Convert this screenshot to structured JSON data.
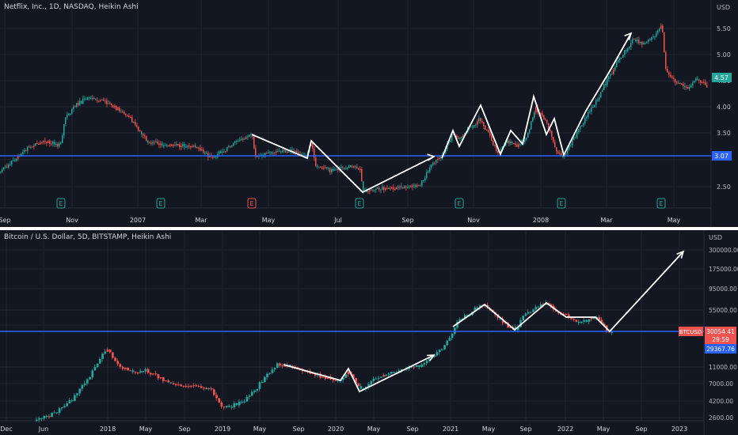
{
  "top_chart": {
    "title": "Netflix, Inc., 1D, NASDAQ, Heikin Ashi",
    "currency": "USD",
    "price_ticks": [
      "2.50",
      "3.00",
      "3.50",
      "4.00",
      "4.50",
      "5.00",
      "5.50"
    ],
    "time_labels": [
      "Sep",
      "Nov",
      "2007",
      "Mar",
      "May",
      "Jul",
      "Sep",
      "Nov",
      "2008",
      "Mar",
      "May"
    ],
    "current_price": "4.57",
    "hline_price": "3.07",
    "earnings_marker_label": "E",
    "colors": {
      "up": "#26a69a",
      "down": "#ef5350",
      "hline": "#2962ff",
      "arrows": "#ffffff"
    }
  },
  "bottom_chart": {
    "title": "Bitcoin / U.S. Dollar, 5D, BITSTAMP, Heikin Ashi",
    "currency": "USD",
    "price_ticks": [
      "2600.00",
      "4200.00",
      "7000.00",
      "11000.00",
      "35000.00",
      "55000.00",
      "95000.00",
      "175000.00",
      "300000.00"
    ],
    "time_labels": [
      "Dec",
      "Jun",
      "2018",
      "May",
      "Sep",
      "2019",
      "May",
      "Sep",
      "2020",
      "May",
      "Sep",
      "2021",
      "May",
      "Sep",
      "2022",
      "May",
      "Sep",
      "2023"
    ],
    "symbol_tag": "BTCUSD",
    "last_price": "30054.41",
    "countdown": "29:59",
    "hline_price": "29367.76",
    "scale": "log",
    "colors": {
      "up": "#26a69a",
      "down": "#ef5350",
      "hline": "#2962ff",
      "arrows": "#ffffff"
    }
  },
  "chart_data": [
    {
      "type": "candlestick",
      "title": "Netflix, Inc., 1D, NASDAQ, Heikin Ashi",
      "x": [
        "Sep",
        "Nov",
        "2007",
        "Mar",
        "May",
        "Jul",
        "Sep",
        "Nov",
        "2008",
        "Mar",
        "May"
      ],
      "values": [
        2.75,
        4.25,
        3.2,
        3.0,
        3.5,
        2.4,
        3.1,
        3.9,
        3.2,
        5.0,
        4.5
      ],
      "ylim": [
        2.2,
        5.8
      ],
      "hline": 3.07,
      "last": 4.57
    },
    {
      "type": "candlestick",
      "title": "Bitcoin / U.S. Dollar, 5D, BITSTAMP, Heikin Ashi",
      "x": [
        "Dec",
        "Jun",
        "2018",
        "May",
        "Sep",
        "2019",
        "May",
        "Sep",
        "2020",
        "May",
        "Sep",
        "2021",
        "May",
        "Sep",
        "2022",
        "May",
        "Sep",
        "2023"
      ],
      "values": [
        2600,
        3000,
        17000,
        8000,
        6500,
        3800,
        10000,
        8000,
        7000,
        9500,
        11000,
        40000,
        60000,
        45000,
        65000,
        30000
      ],
      "ylim": [
        2600,
        300000
      ],
      "scale": "log",
      "hline": 29367.76,
      "last": 30054.41
    }
  ]
}
